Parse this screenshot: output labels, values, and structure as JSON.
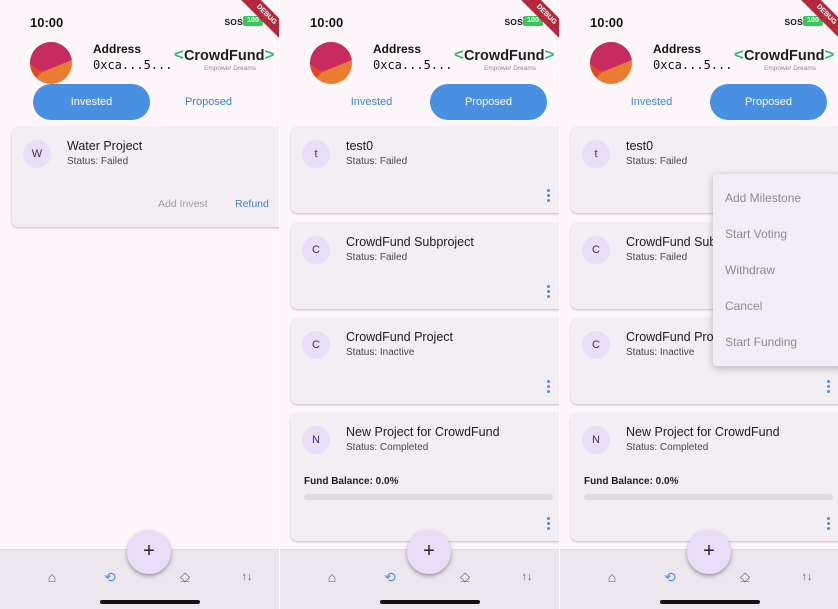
{
  "status": {
    "time": "10:00",
    "sos": "SOS",
    "battery": "100",
    "debug_banner": "DEBUG"
  },
  "header": {
    "address_label": "Address",
    "address_value": "0xca...5...",
    "logo_left": "<",
    "logo_name": "CrowdFund",
    "logo_right": ">",
    "tagline": "Empower Dreams"
  },
  "tabs": {
    "invested": "Invested",
    "proposed": "Proposed"
  },
  "panel1": {
    "cards": [
      {
        "initial": "W",
        "title": "Water Project",
        "status": "Status: Failed",
        "add_invest": "Add Invest",
        "refund": "Refund"
      }
    ]
  },
  "panel2": {
    "cards": [
      {
        "initial": "t",
        "title": "test0",
        "status": "Status: Failed"
      },
      {
        "initial": "C",
        "title": "CrowdFund Subproject",
        "status": "Status: Failed"
      },
      {
        "initial": "C",
        "title": "CrowdFund Project",
        "status": "Status: Inactive"
      },
      {
        "initial": "N",
        "title": "New Project for CrowdFund",
        "status": "Status: Completed",
        "fund_balance": "Fund Balance: 0.0%",
        "progress": 0.0
      }
    ]
  },
  "panel3": {
    "cards": [
      {
        "initial": "t",
        "title": "test0",
        "status": "Status: Failed"
      },
      {
        "initial": "C",
        "title": "CrowdFund Sub",
        "status": "Status: Failed"
      },
      {
        "initial": "C",
        "title": "CrowdFund Pro",
        "status": "Status: Inactive"
      },
      {
        "initial": "N",
        "title": "New Project for CrowdFund",
        "status": "Status: Completed",
        "fund_balance": "Fund Balance: 0.0%",
        "progress": 0.0
      }
    ],
    "menu": [
      "Add Milestone",
      "Start Voting",
      "Withdraw",
      "Cancel",
      "Start Funding"
    ]
  },
  "fab": {
    "label": "+"
  },
  "nav": {
    "icons": [
      "home-icon",
      "history-icon",
      "vote-icon",
      "swap-icon"
    ]
  },
  "colors": {
    "accent": "#4a90e2",
    "logo_green": "#3cb878",
    "card_bg": "#f3eef4",
    "avatar_bg": "#e8def8"
  }
}
